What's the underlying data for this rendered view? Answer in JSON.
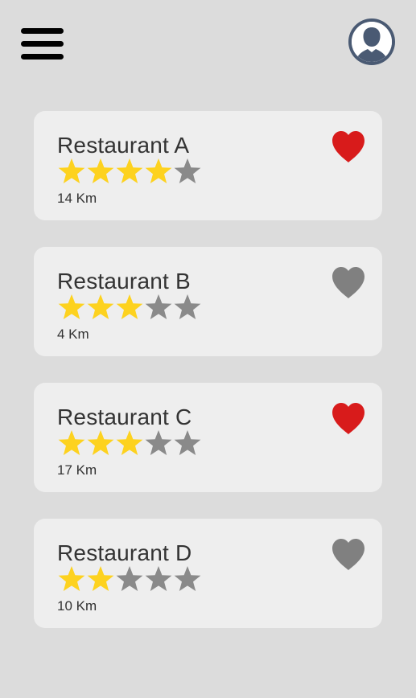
{
  "header": {
    "menu_icon": "hamburger-menu-icon",
    "avatar_icon": "user-avatar-icon"
  },
  "colors": {
    "background": "#dcdcdc",
    "card": "#eeeeee",
    "star_filled": "#fdd21f",
    "star_empty": "#8a8a8a",
    "heart_active": "#d81b1b",
    "heart_inactive": "#808080",
    "avatar_bg": "#4a5a73"
  },
  "restaurants": [
    {
      "name": "Restaurant A",
      "rating": 4,
      "max_rating": 5,
      "distance": "14 Km",
      "favorite": true
    },
    {
      "name": "Restaurant B",
      "rating": 3,
      "max_rating": 5,
      "distance": "4 Km",
      "favorite": false
    },
    {
      "name": "Restaurant C",
      "rating": 3,
      "max_rating": 5,
      "distance": "17 Km",
      "favorite": true
    },
    {
      "name": "Restaurant D",
      "rating": 2,
      "max_rating": 5,
      "distance": "10 Km",
      "favorite": false
    }
  ]
}
